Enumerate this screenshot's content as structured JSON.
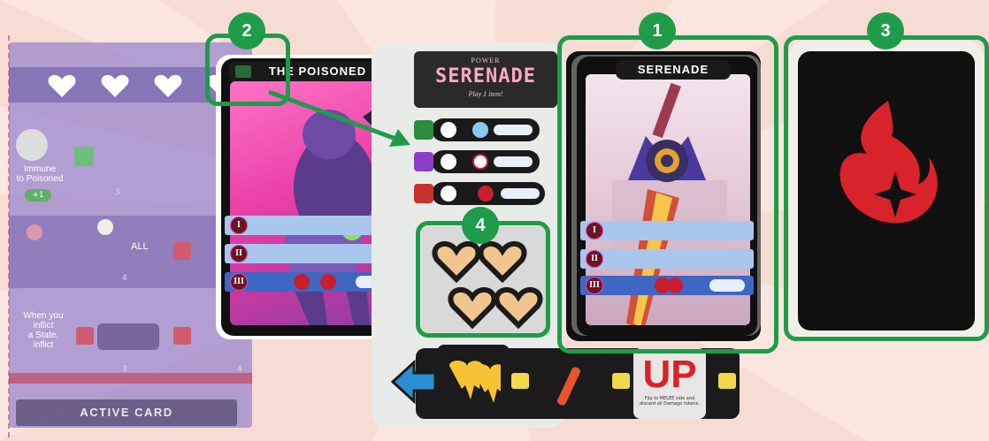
{
  "left_panel": {
    "immune_text": "Immune\nto Poisoned",
    "plus_value": "+1",
    "num_3a": "3",
    "all_label": "ALL",
    "num_4a": "4",
    "num_4b": "4",
    "when_text": "When you\ninflict\na State,\ninflict",
    "num_3b": "3",
    "num_4c": "4",
    "active_card_label": "ACTIVE CARD"
  },
  "poisoned_card": {
    "name": "THE POISONED",
    "tiers": [
      "I",
      "II",
      "III"
    ]
  },
  "power_card": {
    "small_label": "POWER",
    "title": "SERENADE",
    "subtitle": "Play 1 item!"
  },
  "serenade_card": {
    "name": "SERENADE",
    "tiers": [
      "I",
      "II",
      "III"
    ]
  },
  "bottom_strip": {
    "up_text": "UP",
    "small_caption": "Flip to MELEE side and discard all Damage tokens."
  },
  "badges": {
    "b1": "1",
    "b2": "2",
    "b3": "3",
    "b4": "4"
  },
  "colors": {
    "highlight": "#1e9c4a",
    "card_back_icon": "#d8232a"
  }
}
